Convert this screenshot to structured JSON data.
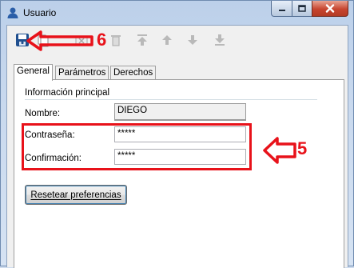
{
  "window": {
    "title": "Usuario"
  },
  "tabs": [
    {
      "label": "General",
      "active": true
    },
    {
      "label": "Parámetros",
      "active": false
    },
    {
      "label": "Derechos",
      "active": false
    }
  ],
  "general": {
    "group_title": "Información principal",
    "nombre_label": "Nombre:",
    "nombre_value": "DIEGO",
    "contrasena_label": "Contraseña:",
    "contrasena_value": "*****",
    "confirmacion_label": "Confirmación:",
    "confirmacion_value": "*****",
    "reset_button": "Resetear preferencias"
  },
  "toolbar_icons": [
    "save-icon",
    "copy-icon",
    "delete-icon",
    "move-first-icon",
    "move-up-icon",
    "move-down-icon",
    "move-last-icon"
  ],
  "annotations": {
    "step_save": "6",
    "step_password": "5"
  },
  "colors": {
    "annotation_red": "#e8121a",
    "close_button": "#c7452f"
  }
}
